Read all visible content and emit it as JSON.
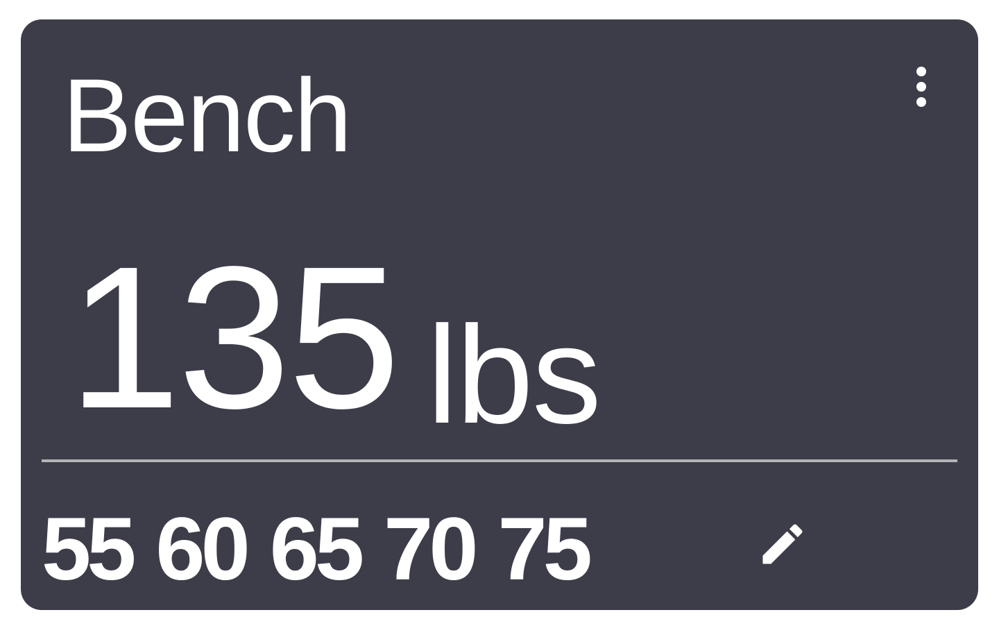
{
  "exercise": {
    "name": "Bench",
    "weight": "135",
    "unit": "lbs"
  },
  "plates": [
    "55",
    "60",
    "65",
    "70",
    "75"
  ],
  "icons": {
    "menu": "more-vertical-icon",
    "edit": "pencil-icon"
  },
  "colors": {
    "card_background": "#3d3d49",
    "text": "#ffffff",
    "divider": "#b4b4b8"
  }
}
